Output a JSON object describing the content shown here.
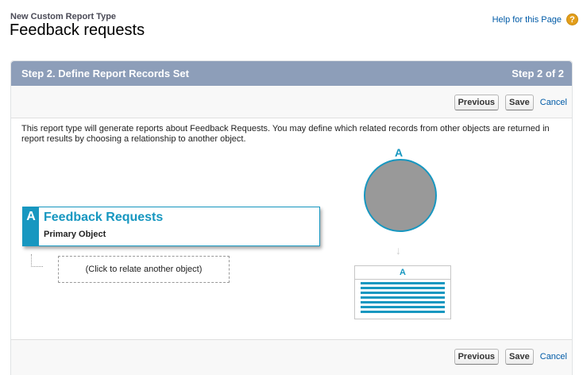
{
  "header": {
    "subtitle": "New Custom Report Type",
    "title": "Feedback requests",
    "help_link": "Help for this Page",
    "help_icon": "?"
  },
  "step": {
    "title": "Step 2. Define Report Records Set",
    "progress": "Step 2 of 2"
  },
  "buttons": {
    "previous": "Previous",
    "save": "Save",
    "cancel": "Cancel"
  },
  "description": "This report type will generate reports about Feedback Requests. You may define which related records from other objects are returned in report results by choosing a relationship to another object.",
  "primary_object": {
    "letter": "A",
    "name": "Feedback Requests",
    "label": "Primary Object"
  },
  "relate_prompt": "(Click to relate another object)",
  "diagram": {
    "circle_label": "A",
    "table_label": "A",
    "arrow": "↓"
  },
  "colors": {
    "header_bar": "#8d9eb9",
    "accent": "#1797c0",
    "help_icon": "#e39e1a",
    "link": "#015ba7"
  },
  "icons": [
    "help-icon",
    "down-arrow-icon"
  ]
}
